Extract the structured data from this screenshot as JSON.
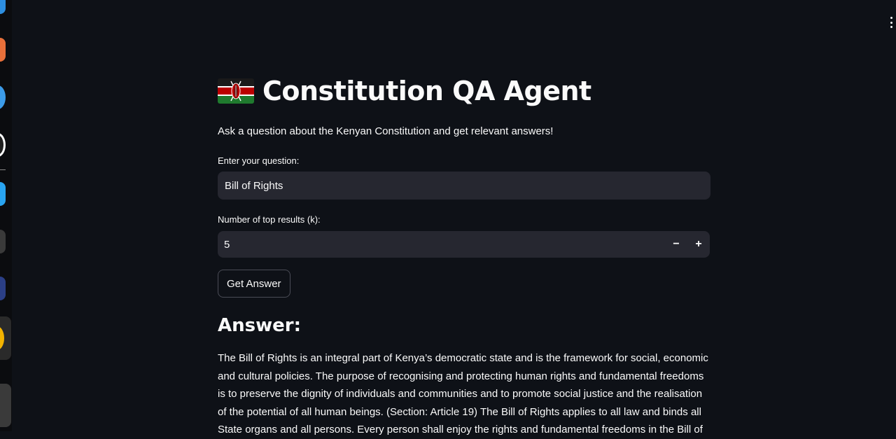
{
  "app": {
    "title": "Constitution QA Agent",
    "subtitle": "Ask a question about the Kenyan Constitution and get relevant answers!",
    "flag_icon": "kenya-flag-icon"
  },
  "form": {
    "question_label": "Enter your question:",
    "question_value": "Bill of Rights",
    "k_label": "Number of top results (k):",
    "k_value": "5",
    "decrement_label": "−",
    "increment_label": "+",
    "submit_label": "Get Answer"
  },
  "answer": {
    "heading": "Answer:",
    "text": "The Bill of Rights is an integral part of Kenya’s democratic state and is the framework for social, economic and cultural policies. The purpose of recognising and protecting human rights and fundamental freedoms is to preserve the dignity of individuals and communities and to promote social justice and the realisation of the potential of all human beings. (Section: Article 19) The Bill of Rights applies to all law and binds all State organs and all persons. Every person shall enjoy the rights and fundamental freedoms in the Bill of"
  },
  "colors": {
    "background": "#0e1117",
    "input_bg": "#262730",
    "text": "#fafafa"
  },
  "dock": {
    "icons": [
      "app-icon",
      "app-icon",
      "app-icon",
      "app-icon",
      "app-icon",
      "app-icon",
      "app-icon",
      "app-icon",
      "app-icon"
    ]
  }
}
